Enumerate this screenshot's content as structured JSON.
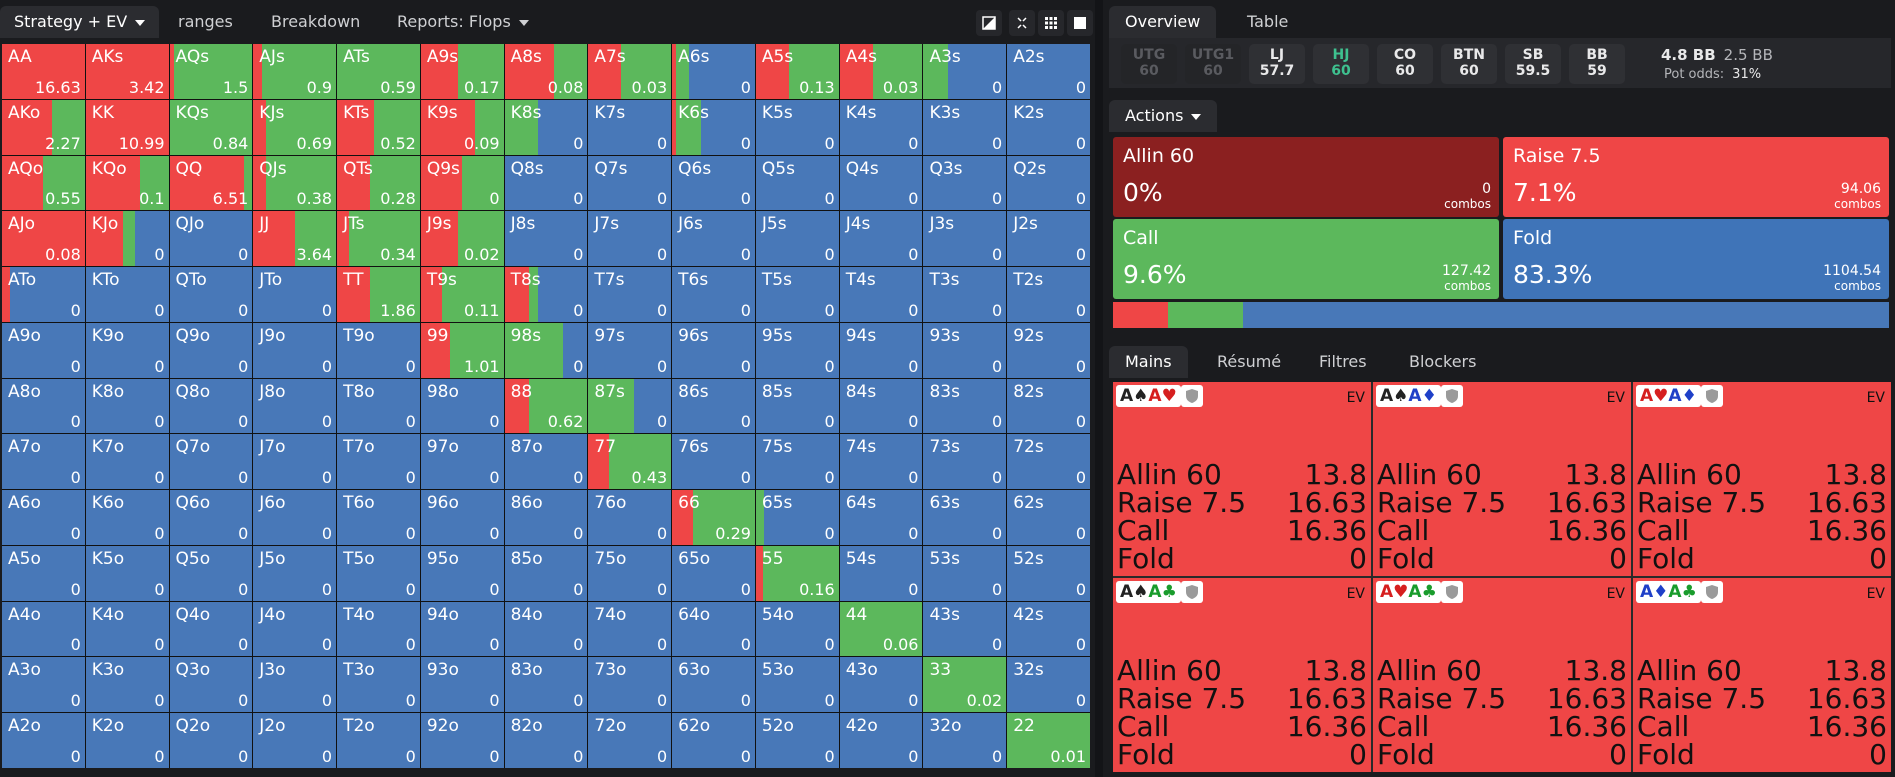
{
  "top_tabs": {
    "strategy": "Strategy + EV",
    "ranges": "ranges",
    "breakdown": "Breakdown",
    "reports": "Reports: Flops"
  },
  "colors": {
    "allin": "#8b2020",
    "raise": "#ef4646",
    "call": "#5cb85c",
    "fold": "#4878b8"
  },
  "grid": [
    [
      {
        "h": "AA",
        "v": "16.63",
        "r": 1
      },
      {
        "h": "AKs",
        "v": "3.42",
        "r": 1
      },
      {
        "h": "AQs",
        "v": "1.5",
        "r": 0.05,
        "c": 0.95
      },
      {
        "h": "AJs",
        "v": "0.9",
        "r": 0.1,
        "c": 0.9
      },
      {
        "h": "ATs",
        "v": "0.59",
        "c": 1
      },
      {
        "h": "A9s",
        "v": "0.17",
        "r": 0.45,
        "c": 0.55
      },
      {
        "h": "A8s",
        "v": "0.08",
        "r": 0.6,
        "c": 0.4
      },
      {
        "h": "A7s",
        "v": "0.03",
        "r": 0.4,
        "c": 0.6
      },
      {
        "h": "A6s",
        "v": "0",
        "r": 0.05,
        "c": 0.15,
        "f": 0.8
      },
      {
        "h": "A5s",
        "v": "0.13",
        "r": 0.4,
        "c": 0.6
      },
      {
        "h": "A4s",
        "v": "0.03",
        "r": 0.4,
        "c": 0.6
      },
      {
        "h": "A3s",
        "v": "0",
        "c": 0.3,
        "f": 0.7
      },
      {
        "h": "A2s",
        "v": "0",
        "f": 1
      }
    ],
    [
      {
        "h": "AKo",
        "v": "2.27",
        "r": 0.6,
        "c": 0.4
      },
      {
        "h": "KK",
        "v": "10.99",
        "r": 1
      },
      {
        "h": "KQs",
        "v": "0.84",
        "c": 1
      },
      {
        "h": "KJs",
        "v": "0.69",
        "r": 0.15,
        "c": 0.85
      },
      {
        "h": "KTs",
        "v": "0.52",
        "r": 0.45,
        "c": 0.55
      },
      {
        "h": "K9s",
        "v": "0.09",
        "r": 0.65,
        "c": 0.35
      },
      {
        "h": "K8s",
        "v": "0",
        "c": 0.4,
        "f": 0.6
      },
      {
        "h": "K7s",
        "v": "0",
        "f": 1
      },
      {
        "h": "K6s",
        "v": "0",
        "r": 0.05,
        "c": 0.3,
        "f": 0.65
      },
      {
        "h": "K5s",
        "v": "0",
        "f": 1
      },
      {
        "h": "K4s",
        "v": "0",
        "f": 1
      },
      {
        "h": "K3s",
        "v": "0",
        "f": 1
      },
      {
        "h": "K2s",
        "v": "0",
        "f": 1
      }
    ],
    [
      {
        "h": "AQo",
        "v": "0.55",
        "r": 0.5,
        "c": 0.5
      },
      {
        "h": "KQo",
        "v": "0.1",
        "r": 0.65,
        "c": 0.35
      },
      {
        "h": "QQ",
        "v": "6.51",
        "r": 0.9,
        "c": 0.1
      },
      {
        "h": "QJs",
        "v": "0.38",
        "r": 0.15,
        "c": 0.85
      },
      {
        "h": "QTs",
        "v": "0.28",
        "r": 0.4,
        "c": 0.6
      },
      {
        "h": "Q9s",
        "v": "0",
        "r": 0.5,
        "c": 0.5
      },
      {
        "h": "Q8s",
        "v": "0",
        "f": 1
      },
      {
        "h": "Q7s",
        "v": "0",
        "f": 1
      },
      {
        "h": "Q6s",
        "v": "0",
        "f": 1
      },
      {
        "h": "Q5s",
        "v": "0",
        "f": 1
      },
      {
        "h": "Q4s",
        "v": "0",
        "f": 1
      },
      {
        "h": "Q3s",
        "v": "0",
        "f": 1
      },
      {
        "h": "Q2s",
        "v": "0",
        "f": 1
      }
    ],
    [
      {
        "h": "AJo",
        "v": "0.08",
        "r": 1
      },
      {
        "h": "KJo",
        "v": "0",
        "r": 0.45,
        "c": 0.15,
        "f": 0.4
      },
      {
        "h": "QJo",
        "v": "0",
        "f": 1
      },
      {
        "h": "JJ",
        "v": "3.64",
        "r": 0.5,
        "c": 0.5
      },
      {
        "h": "JTs",
        "v": "0.34",
        "r": 0.15,
        "c": 0.85
      },
      {
        "h": "J9s",
        "v": "0.02",
        "r": 0.45,
        "c": 0.55
      },
      {
        "h": "J8s",
        "v": "0",
        "f": 1
      },
      {
        "h": "J7s",
        "v": "0",
        "f": 1
      },
      {
        "h": "J6s",
        "v": "0",
        "f": 1
      },
      {
        "h": "J5s",
        "v": "0",
        "f": 1
      },
      {
        "h": "J4s",
        "v": "0",
        "f": 1
      },
      {
        "h": "J3s",
        "v": "0",
        "f": 1
      },
      {
        "h": "J2s",
        "v": "0",
        "f": 1
      }
    ],
    [
      {
        "h": "ATo",
        "v": "0",
        "r": 0.1,
        "f": 0.9
      },
      {
        "h": "KTo",
        "v": "0",
        "f": 1
      },
      {
        "h": "QTo",
        "v": "0",
        "f": 1
      },
      {
        "h": "JTo",
        "v": "0",
        "f": 1
      },
      {
        "h": "TT",
        "v": "1.86",
        "r": 0.4,
        "c": 0.6
      },
      {
        "h": "T9s",
        "v": "0.11",
        "r": 0.25,
        "c": 0.75
      },
      {
        "h": "T8s",
        "v": "0",
        "r": 0.3,
        "c": 0.1,
        "f": 0.6
      },
      {
        "h": "T7s",
        "v": "0",
        "f": 1
      },
      {
        "h": "T6s",
        "v": "0",
        "f": 1
      },
      {
        "h": "T5s",
        "v": "0",
        "f": 1
      },
      {
        "h": "T4s",
        "v": "0",
        "f": 1
      },
      {
        "h": "T3s",
        "v": "0",
        "f": 1
      },
      {
        "h": "T2s",
        "v": "0",
        "f": 1
      }
    ],
    [
      {
        "h": "A9o",
        "v": "0",
        "f": 1
      },
      {
        "h": "K9o",
        "v": "0",
        "f": 1
      },
      {
        "h": "Q9o",
        "v": "0",
        "f": 1
      },
      {
        "h": "J9o",
        "v": "0",
        "f": 1
      },
      {
        "h": "T9o",
        "v": "0",
        "f": 1
      },
      {
        "h": "99",
        "v": "1.01",
        "r": 0.35,
        "c": 0.65
      },
      {
        "h": "98s",
        "v": "0",
        "c": 0.7,
        "f": 0.3
      },
      {
        "h": "97s",
        "v": "0",
        "f": 1
      },
      {
        "h": "96s",
        "v": "0",
        "f": 1
      },
      {
        "h": "95s",
        "v": "0",
        "f": 1
      },
      {
        "h": "94s",
        "v": "0",
        "f": 1
      },
      {
        "h": "93s",
        "v": "0",
        "f": 1
      },
      {
        "h": "92s",
        "v": "0",
        "f": 1
      }
    ],
    [
      {
        "h": "A8o",
        "v": "0",
        "f": 1
      },
      {
        "h": "K8o",
        "v": "0",
        "f": 1
      },
      {
        "h": "Q8o",
        "v": "0",
        "f": 1
      },
      {
        "h": "J8o",
        "v": "0",
        "f": 1
      },
      {
        "h": "T8o",
        "v": "0",
        "f": 1
      },
      {
        "h": "98o",
        "v": "0",
        "f": 1
      },
      {
        "h": "88",
        "v": "0.62",
        "r": 0.3,
        "c": 0.7
      },
      {
        "h": "87s",
        "v": "0",
        "c": 0.55,
        "f": 0.45
      },
      {
        "h": "86s",
        "v": "0",
        "f": 1
      },
      {
        "h": "85s",
        "v": "0",
        "f": 1
      },
      {
        "h": "84s",
        "v": "0",
        "f": 1
      },
      {
        "h": "83s",
        "v": "0",
        "f": 1
      },
      {
        "h": "82s",
        "v": "0",
        "f": 1
      }
    ],
    [
      {
        "h": "A7o",
        "v": "0",
        "f": 1
      },
      {
        "h": "K7o",
        "v": "0",
        "f": 1
      },
      {
        "h": "Q7o",
        "v": "0",
        "f": 1
      },
      {
        "h": "J7o",
        "v": "0",
        "f": 1
      },
      {
        "h": "T7o",
        "v": "0",
        "f": 1
      },
      {
        "h": "97o",
        "v": "0",
        "f": 1
      },
      {
        "h": "87o",
        "v": "0",
        "f": 1
      },
      {
        "h": "77",
        "v": "0.43",
        "r": 0.25,
        "c": 0.75
      },
      {
        "h": "76s",
        "v": "0",
        "f": 1
      },
      {
        "h": "75s",
        "v": "0",
        "f": 1
      },
      {
        "h": "74s",
        "v": "0",
        "f": 1
      },
      {
        "h": "73s",
        "v": "0",
        "f": 1
      },
      {
        "h": "72s",
        "v": "0",
        "f": 1
      }
    ],
    [
      {
        "h": "A6o",
        "v": "0",
        "f": 1
      },
      {
        "h": "K6o",
        "v": "0",
        "f": 1
      },
      {
        "h": "Q6o",
        "v": "0",
        "f": 1
      },
      {
        "h": "J6o",
        "v": "0",
        "f": 1
      },
      {
        "h": "T6o",
        "v": "0",
        "f": 1
      },
      {
        "h": "96o",
        "v": "0",
        "f": 1
      },
      {
        "h": "86o",
        "v": "0",
        "f": 1
      },
      {
        "h": "76o",
        "v": "0",
        "f": 1
      },
      {
        "h": "66",
        "v": "0.29",
        "r": 0.25,
        "c": 0.75
      },
      {
        "h": "65s",
        "v": "0",
        "c": 0.1,
        "f": 0.9
      },
      {
        "h": "64s",
        "v": "0",
        "f": 1
      },
      {
        "h": "63s",
        "v": "0",
        "f": 1
      },
      {
        "h": "62s",
        "v": "0",
        "f": 1
      }
    ],
    [
      {
        "h": "A5o",
        "v": "0",
        "f": 1
      },
      {
        "h": "K5o",
        "v": "0",
        "f": 1
      },
      {
        "h": "Q5o",
        "v": "0",
        "f": 1
      },
      {
        "h": "J5o",
        "v": "0",
        "f": 1
      },
      {
        "h": "T5o",
        "v": "0",
        "f": 1
      },
      {
        "h": "95o",
        "v": "0",
        "f": 1
      },
      {
        "h": "85o",
        "v": "0",
        "f": 1
      },
      {
        "h": "75o",
        "v": "0",
        "f": 1
      },
      {
        "h": "65o",
        "v": "0",
        "f": 1
      },
      {
        "h": "55",
        "v": "0.16",
        "r": 0.08,
        "c": 0.92
      },
      {
        "h": "54s",
        "v": "0",
        "f": 1
      },
      {
        "h": "53s",
        "v": "0",
        "f": 1
      },
      {
        "h": "52s",
        "v": "0",
        "f": 1
      }
    ],
    [
      {
        "h": "A4o",
        "v": "0",
        "f": 1
      },
      {
        "h": "K4o",
        "v": "0",
        "f": 1
      },
      {
        "h": "Q4o",
        "v": "0",
        "f": 1
      },
      {
        "h": "J4o",
        "v": "0",
        "f": 1
      },
      {
        "h": "T4o",
        "v": "0",
        "f": 1
      },
      {
        "h": "94o",
        "v": "0",
        "f": 1
      },
      {
        "h": "84o",
        "v": "0",
        "f": 1
      },
      {
        "h": "74o",
        "v": "0",
        "f": 1
      },
      {
        "h": "64o",
        "v": "0",
        "f": 1
      },
      {
        "h": "54o",
        "v": "0",
        "f": 1
      },
      {
        "h": "44",
        "v": "0.06",
        "c": 1
      },
      {
        "h": "43s",
        "v": "0",
        "f": 1
      },
      {
        "h": "42s",
        "v": "0",
        "f": 1
      }
    ],
    [
      {
        "h": "A3o",
        "v": "0",
        "f": 1
      },
      {
        "h": "K3o",
        "v": "0",
        "f": 1
      },
      {
        "h": "Q3o",
        "v": "0",
        "f": 1
      },
      {
        "h": "J3o",
        "v": "0",
        "f": 1
      },
      {
        "h": "T3o",
        "v": "0",
        "f": 1
      },
      {
        "h": "93o",
        "v": "0",
        "f": 1
      },
      {
        "h": "83o",
        "v": "0",
        "f": 1
      },
      {
        "h": "73o",
        "v": "0",
        "f": 1
      },
      {
        "h": "63o",
        "v": "0",
        "f": 1
      },
      {
        "h": "53o",
        "v": "0",
        "f": 1
      },
      {
        "h": "43o",
        "v": "0",
        "f": 1
      },
      {
        "h": "33",
        "v": "0.02",
        "c": 1
      },
      {
        "h": "32s",
        "v": "0",
        "f": 1
      }
    ],
    [
      {
        "h": "A2o",
        "v": "0",
        "f": 1
      },
      {
        "h": "K2o",
        "v": "0",
        "f": 1
      },
      {
        "h": "Q2o",
        "v": "0",
        "f": 1
      },
      {
        "h": "J2o",
        "v": "0",
        "f": 1
      },
      {
        "h": "T2o",
        "v": "0",
        "f": 1
      },
      {
        "h": "92o",
        "v": "0",
        "f": 1
      },
      {
        "h": "82o",
        "v": "0",
        "f": 1
      },
      {
        "h": "72o",
        "v": "0",
        "f": 1
      },
      {
        "h": "62o",
        "v": "0",
        "f": 1
      },
      {
        "h": "52o",
        "v": "0",
        "f": 1
      },
      {
        "h": "42o",
        "v": "0",
        "f": 1
      },
      {
        "h": "32o",
        "v": "0",
        "f": 1
      },
      {
        "h": "22",
        "v": "0.01",
        "c": 1
      }
    ]
  ],
  "right_tabs": {
    "overview": "Overview",
    "table": "Table"
  },
  "positions": [
    {
      "name": "UTG",
      "stack": "60",
      "state": "dim"
    },
    {
      "name": "UTG1",
      "stack": "60",
      "state": "dim"
    },
    {
      "name": "LJ",
      "stack": "57.7",
      "state": "normal"
    },
    {
      "name": "HJ",
      "stack": "60",
      "state": "highlight"
    },
    {
      "name": "CO",
      "stack": "60",
      "state": "normal"
    },
    {
      "name": "BTN",
      "stack": "60",
      "state": "normal"
    },
    {
      "name": "SB",
      "stack": "59.5",
      "state": "normal"
    },
    {
      "name": "BB",
      "stack": "59",
      "state": "normal"
    }
  ],
  "pot": {
    "bb_main": "4.8 BB",
    "bb_secondary": "2.5 BB",
    "odds_label": "Pot odds:",
    "odds_value": "31%"
  },
  "actions_label": "Actions",
  "actions": [
    {
      "title": "Allin 60",
      "pct": "0%",
      "combos": "0",
      "combos_label": "combos",
      "color": "#8b2020"
    },
    {
      "title": "Raise 7.5",
      "pct": "7.1%",
      "combos": "94.06",
      "combos_label": "combos",
      "color": "#ef4646"
    },
    {
      "title": "Call",
      "pct": "9.6%",
      "combos": "127.42",
      "combos_label": "combos",
      "color": "#5cb85c"
    },
    {
      "title": "Fold",
      "pct": "83.3%",
      "combos": "1104.54",
      "combos_label": "combos",
      "color": "#3f74b8"
    }
  ],
  "freq_bar": [
    {
      "action": "raise",
      "frac": 0.071
    },
    {
      "action": "call",
      "frac": 0.096
    },
    {
      "action": "fold",
      "frac": 0.833
    }
  ],
  "hands_tabs": {
    "mains": "Mains",
    "resume": "Résumé",
    "filtres": "Filtres",
    "blockers": "Blockers"
  },
  "combos": [
    {
      "cards": [
        [
          "A♠",
          "blk"
        ],
        [
          "A♥",
          "red"
        ]
      ]
    },
    {
      "cards": [
        [
          "A♠",
          "blk"
        ],
        [
          "A♦",
          "blu"
        ]
      ]
    },
    {
      "cards": [
        [
          "A♥",
          "red"
        ],
        [
          "A♦",
          "blu"
        ]
      ]
    },
    {
      "cards": [
        [
          "A♠",
          "blk"
        ],
        [
          "A♣",
          "grn"
        ]
      ]
    },
    {
      "cards": [
        [
          "A♥",
          "red"
        ],
        [
          "A♣",
          "grn"
        ]
      ]
    },
    {
      "cards": [
        [
          "A♦",
          "blu"
        ],
        [
          "A♣",
          "grn"
        ]
      ]
    }
  ],
  "combo_ev_label": "EV",
  "combo_rows": [
    {
      "action": "Allin 60",
      "ev": "13.8"
    },
    {
      "action": "Raise 7.5",
      "ev": "16.63"
    },
    {
      "action": "Call",
      "ev": "16.36"
    },
    {
      "action": "Fold",
      "ev": "0"
    }
  ]
}
